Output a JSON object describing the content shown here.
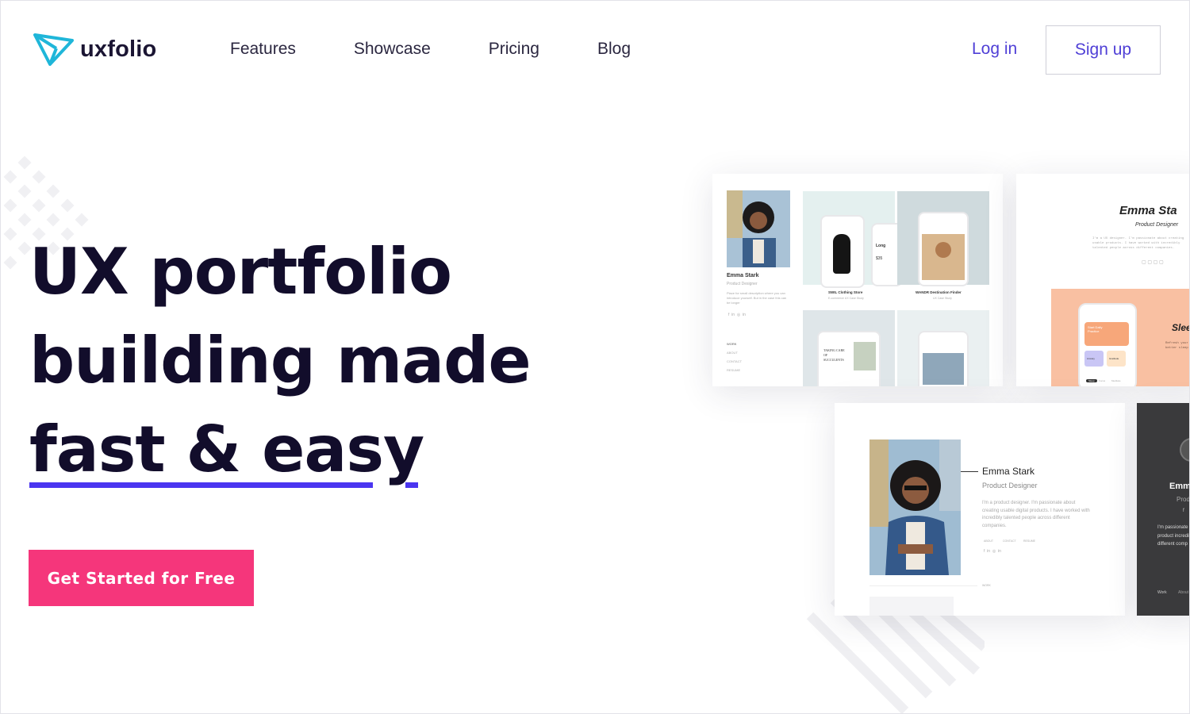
{
  "brand": {
    "name": "uxfolio",
    "logo_color": "#1fb6d9"
  },
  "nav": {
    "items": [
      {
        "label": "Features"
      },
      {
        "label": "Showcase"
      },
      {
        "label": "Pricing"
      },
      {
        "label": "Blog"
      }
    ],
    "login_label": "Log in",
    "signup_label": "Sign up"
  },
  "hero": {
    "line1": "UX portfolio",
    "line2": "building made",
    "line3": "fast & easy",
    "cta_label": "Get Started for Free",
    "cta_color": "#f5367b",
    "accent_color": "#4a35f0"
  },
  "preview": {
    "card1": {
      "name": "Emma Stark",
      "role": "Product Designer",
      "bio": "Place for small description where you can introduce yourself. But in the case this can be longer",
      "menu": [
        "WORK",
        "ABOUT",
        "CONTACT",
        "RESUME"
      ],
      "projects": [
        {
          "title": "SWIL Clothing Store",
          "subtitle": "E-commerce UX Case Study"
        },
        {
          "title": "WANDR Destination Finder",
          "subtitle": "UX Case Study"
        }
      ],
      "phone_text_1": "Long",
      "phone_price": "$35",
      "succulents": "TAKING CARE OF SUCCULENTS"
    },
    "card2": {
      "name": "Emma Sta",
      "role": "Product Designer",
      "bio": "I'm a UX designer. I'm passionate about creating usable products. I have worked with incredibly talented people across different companies.",
      "headline": "Slee",
      "snippet": "Refresh your sleep, better sleep",
      "app_card_title": "Start Daily Practice",
      "app_card_1": "Anxiety",
      "app_card_2": "Gratitude",
      "tabs": [
        "Sleep",
        "Focus",
        "Meditate"
      ]
    },
    "card3": {
      "name": "Emma Stark",
      "role": "Product Designer",
      "bio": "I'm a product designer. I'm passionate about creating usable digital products. I have worked with incredibly talented people across different companies.",
      "links": [
        "ABOUT",
        "CONTACT",
        "RESUME"
      ],
      "footer": "WORK"
    },
    "card4": {
      "name": "Emm",
      "role": "Prod",
      "bio": "I'm passionate digital product incredibly tale different comp",
      "footer_1": "Work",
      "footer_2": "About"
    }
  }
}
